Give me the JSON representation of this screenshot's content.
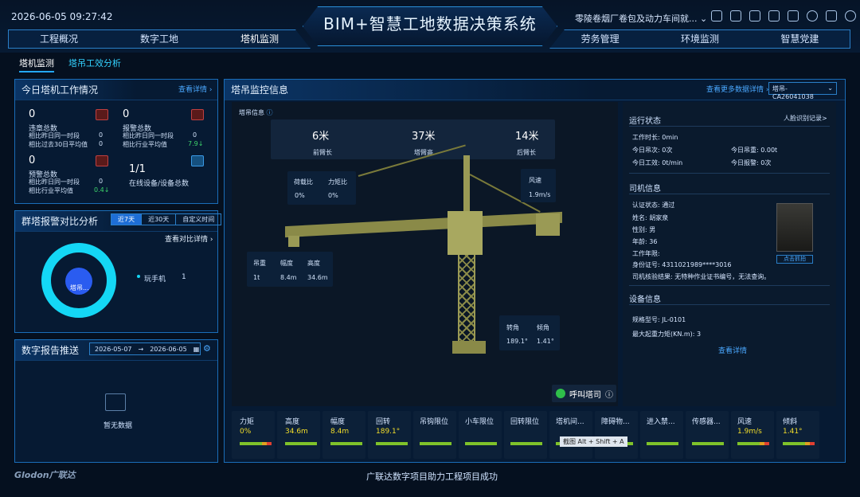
{
  "header": {
    "datetime": "2026-06-05 09:27:42",
    "title": "BIM+智慧工地数据决策系统",
    "project": "零陵卷烟厂卷包及动力车间就...",
    "nav_left": [
      "工程概况",
      "数字工地",
      "塔机监测"
    ],
    "nav_right": [
      "劳务管理",
      "环境监测",
      "智慧党建"
    ]
  },
  "subtabs": [
    "塔机监测",
    "塔吊工效分析"
  ],
  "work_panel": {
    "title": "今日塔机工作情况",
    "link": "查看详情 ›",
    "violation": {
      "value": "0",
      "label": "违章总数",
      "r1": "相比昨日同一时段",
      "v1": "0",
      "r2": "相比过去30日平均值",
      "v2": "0"
    },
    "alarm": {
      "value": "0",
      "label": "报警总数",
      "r1": "相比昨日同一时段",
      "v1": "0",
      "r2": "相比行业平均值",
      "v2": "7.9↓"
    },
    "warning": {
      "value": "0",
      "label": "预警总数",
      "r1": "相比昨日同一时段",
      "v1": "0",
      "r2": "相比行业平均值",
      "v2": "0.4↓"
    },
    "online": {
      "value": "1/1",
      "label": "在线设备/设备总数"
    }
  },
  "group_panel": {
    "title": "群塔报警对比分析",
    "tabs": [
      "近7天",
      "近30天",
      "自定义时间"
    ],
    "link": "查看对比详情 ›",
    "legend": "玩手机",
    "legend_value": "1",
    "donut_label": "塔吊..."
  },
  "report_panel": {
    "title": "数字报告推送",
    "date_from": "2026-05-07",
    "date_to": "2026-06-05",
    "empty": "暂无数据"
  },
  "monitor": {
    "title": "塔吊监控信息",
    "link": "查看更多数据详情 ›",
    "select": "塔吊-CA26041038",
    "info_label": "塔吊信息",
    "top": [
      {
        "v": "6米",
        "l": "前臂长"
      },
      {
        "v": "37米",
        "l": "塔臂高"
      },
      {
        "v": "14米",
        "l": "后臂长"
      }
    ],
    "load_ratio": {
      "l1": "荷载比",
      "l2": "力矩比",
      "v1": "0%",
      "v2": "0%"
    },
    "wind": {
      "l": "风速",
      "v": "1.9m/s"
    },
    "hook": {
      "l1": "吊重",
      "l2": "幅度",
      "l3": "高度",
      "v1": "1t",
      "v2": "8.4m",
      "v3": "34.6m"
    },
    "rotate": {
      "l1": "转角",
      "l2": "倾角",
      "v1": "189.1°",
      "v2": "1.41°"
    },
    "call": "呼叫塔司"
  },
  "status": {
    "title": "运行状态",
    "link": "人脸识别记录>",
    "work_time": "工作时长: 0min",
    "lift_count": "今日吊次: 0次",
    "lift_weight": "今日吊重: 0.00t",
    "efficiency": "今日工效: 0t/min",
    "alarms": "今日报警: 0次"
  },
  "driver": {
    "title": "司机信息",
    "cert": "认证状态: 通过",
    "name": "姓名: 胡家泉",
    "gender": "性别: 男",
    "age": "年龄: 36",
    "years": "工作年限:",
    "idno": "身份证号: 4311021989****3016",
    "check": "司机核验结果: 无特种作业证书编号，无法查询。",
    "photo_btn": "点击抓拍"
  },
  "device": {
    "title": "设备信息",
    "model": "规格型号: JL-0101",
    "torque": "最大起重力矩(KN.m): 3",
    "link": "查看详情"
  },
  "bottom": [
    {
      "n": "力矩",
      "v": "0%"
    },
    {
      "n": "高度",
      "v": "34.6m"
    },
    {
      "n": "幅度",
      "v": "8.4m"
    },
    {
      "n": "回转",
      "v": "189.1°"
    },
    {
      "n": "吊钩限位",
      "v": ""
    },
    {
      "n": "小车限位",
      "v": ""
    },
    {
      "n": "回转限位",
      "v": ""
    },
    {
      "n": "塔机间...",
      "v": ""
    },
    {
      "n": "障碍物...",
      "v": ""
    },
    {
      "n": "进入禁...",
      "v": ""
    },
    {
      "n": "传感器...",
      "v": ""
    },
    {
      "n": "风速",
      "v": "1.9m/s"
    },
    {
      "n": "倾斜",
      "v": "1.41°"
    }
  ],
  "tooltip": "截图 Alt + Shift + A",
  "footer": {
    "logo": "Glodon广联达",
    "slogan": "广联达数字项目助力工程项目成功"
  }
}
